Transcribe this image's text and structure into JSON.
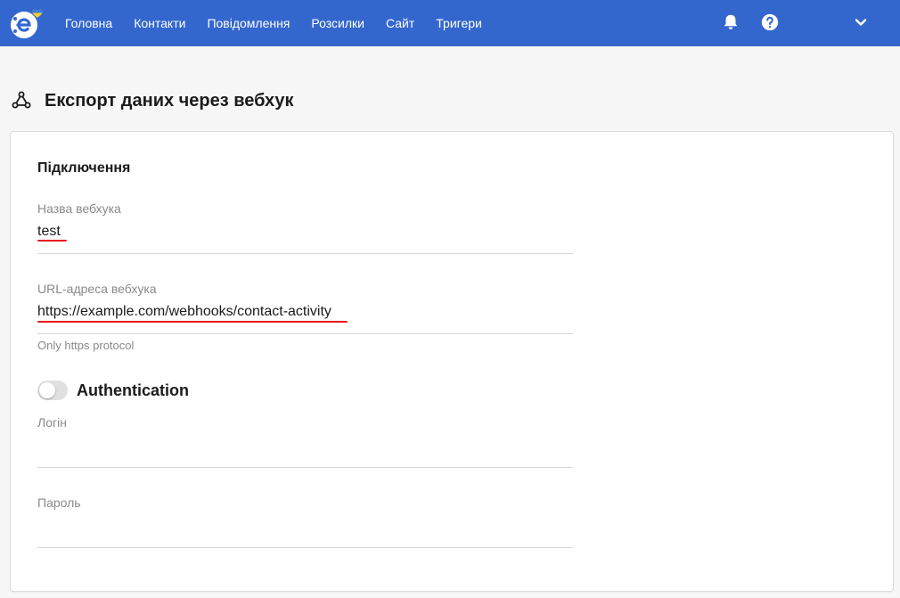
{
  "nav": {
    "items": [
      "Головна",
      "Контакти",
      "Повідомлення",
      "Розсилки",
      "Сайт",
      "Тригери"
    ]
  },
  "icons": {
    "logo": "esputnik-logo-icon",
    "bell": "bell-icon",
    "help": "question-circle-icon",
    "menu": "chevron-down-icon",
    "webhook": "webhook-icon"
  },
  "colors": {
    "topbar": "#3467ce",
    "annotation": "#e8151d",
    "flag_blue": "#3a7be0",
    "flag_yellow": "#f5cf2a"
  },
  "page": {
    "title": "Експорт даних через вебхук"
  },
  "connection": {
    "section_title": "Підключення",
    "name_label": "Назва вебхука",
    "name_value": "test",
    "url_label": "URL-адреса вебхука",
    "url_value": "https://example.com/webhooks/contact-activity",
    "url_hint": "Only https protocol"
  },
  "auth": {
    "label": "Authentication",
    "enabled": false,
    "login_label": "Логін",
    "login_value": "",
    "password_label": "Пароль",
    "password_value": ""
  }
}
